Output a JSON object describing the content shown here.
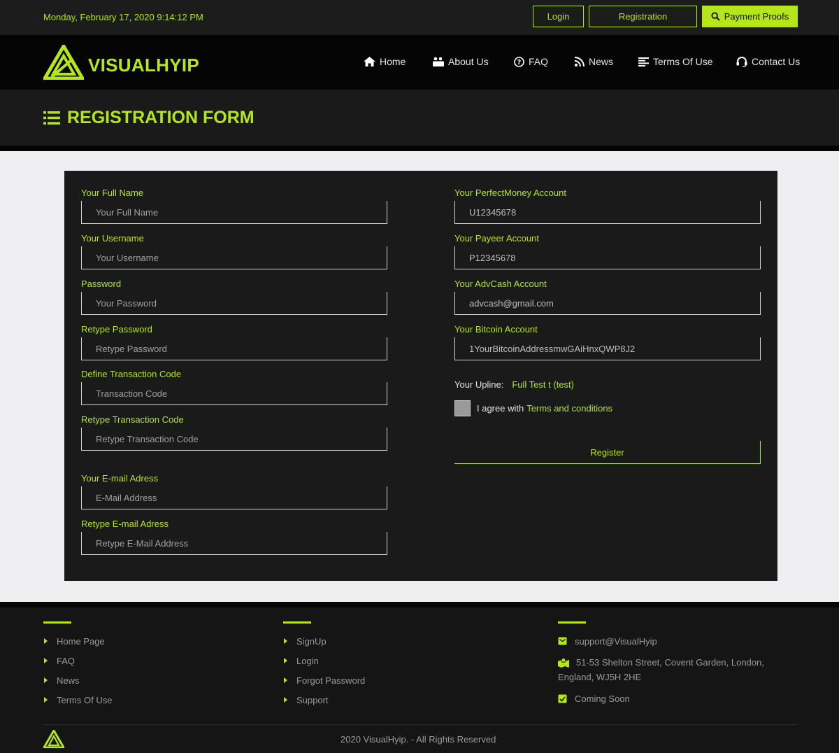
{
  "topbar": {
    "datetime": "Monday, February 17, 2020 9:14:12 PM",
    "login_label": "Login",
    "registration_label": "Registration",
    "payment_proofs_label": "Payment Proofs"
  },
  "brand": {
    "name": "VISUALHYIP",
    "accent_color": "#b5e61d"
  },
  "nav": {
    "home": "Home",
    "about": "About Us",
    "faq": "FAQ",
    "news": "News",
    "terms": "Terms Of Use",
    "contact": "Contact Us"
  },
  "page_title": "REGISTRATION FORM",
  "form": {
    "full_name": {
      "label": "Your Full Name",
      "placeholder": "Your Full Name"
    },
    "username": {
      "label": "Your Username",
      "placeholder": "Your Username"
    },
    "password": {
      "label": "Password",
      "placeholder": "Your Password"
    },
    "retype_password": {
      "label": "Retype Password",
      "placeholder": "Retype Password"
    },
    "transaction_code": {
      "label": "Define Transaction Code",
      "placeholder": "Transaction Code"
    },
    "retype_transaction_code": {
      "label": "Retype Transaction Code",
      "placeholder": "Retype Transaction Code"
    },
    "email": {
      "label": "Your E-mail Adress",
      "placeholder": "E-Mail Address"
    },
    "retype_email": {
      "label": "Retype E-mail Adress",
      "placeholder": "Retype E-Mail Address"
    },
    "perfectmoney": {
      "label": "Your PerfectMoney Account",
      "value": "U12345678"
    },
    "payeer": {
      "label": "Your Payeer Account",
      "value": "P12345678"
    },
    "advcash": {
      "label": "Your AdvCash Account",
      "value": "advcash@gmail.com"
    },
    "bitcoin": {
      "label": "Your Bitcoin Account",
      "value": "1YourBitcoinAddressmwGAiHnxQWP8J2"
    },
    "upline_label": "Your Upline:",
    "upline_value": "Full Test t (test)",
    "agree_text": "I agree with",
    "terms_link": "Terms and conditions",
    "register_label": "Register"
  },
  "footer": {
    "col1": [
      "Home Page",
      "FAQ",
      "News",
      "Terms Of Use"
    ],
    "col2": [
      "SignUp",
      "Login",
      "Forgot Password",
      "Support"
    ],
    "email": "support@VisualHyip",
    "address": "51-53 Shelton Street, Covent Garden, London, England, WJ5H 2HE",
    "coming_soon": "Coming Soon",
    "copyright": "2020 VisualHyip. - All Rights Reserved"
  }
}
